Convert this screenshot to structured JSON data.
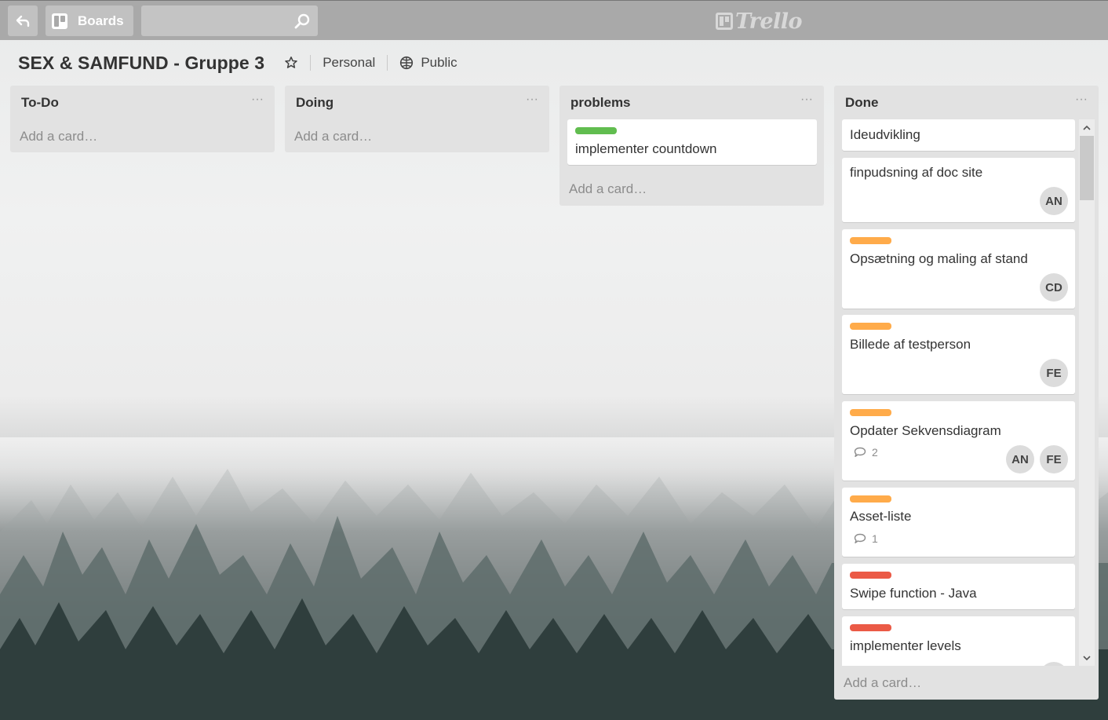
{
  "topbar": {
    "boards_label": "Boards",
    "search": {
      "placeholder": "",
      "value": ""
    },
    "logo_text": "Trello",
    "bg_color": "#a9a9a9"
  },
  "board": {
    "title": "SEX & SAMFUND - Gruppe 3",
    "team": "Personal",
    "visibility": "Public"
  },
  "colors": {
    "green": "#61bd4f",
    "orange": "#ffab4a",
    "red": "#eb5a46"
  },
  "lists": [
    {
      "title": "To-Do",
      "menu": "···",
      "add_card": "Add a card…"
    },
    {
      "title": "Doing",
      "menu": "···",
      "add_card": "Add a card…"
    },
    {
      "title": "problems",
      "menu": "···",
      "add_card": "Add a card…",
      "cards": [
        {
          "title": "implementer countdown",
          "label": "green"
        }
      ]
    },
    {
      "title": "Done",
      "menu": "···",
      "add_card": "Add a card…",
      "cards": [
        {
          "title": "Ideudvikling"
        },
        {
          "title": "finpudsning af doc site",
          "members": [
            "AN"
          ]
        },
        {
          "title": "Opsætning og maling af stand",
          "label": "orange",
          "members": [
            "CD"
          ]
        },
        {
          "title": "Billede af testperson",
          "label": "orange",
          "members": [
            "FE"
          ]
        },
        {
          "title": "Opdater Sekvensdiagram",
          "label": "orange",
          "comments": "2",
          "members": [
            "AN",
            "FE"
          ]
        },
        {
          "title": "Asset-liste",
          "label": "orange",
          "comments": "1"
        },
        {
          "title": "Swipe function - Java",
          "label": "red"
        },
        {
          "title": "implementer levels",
          "label": "red"
        }
      ]
    }
  ]
}
